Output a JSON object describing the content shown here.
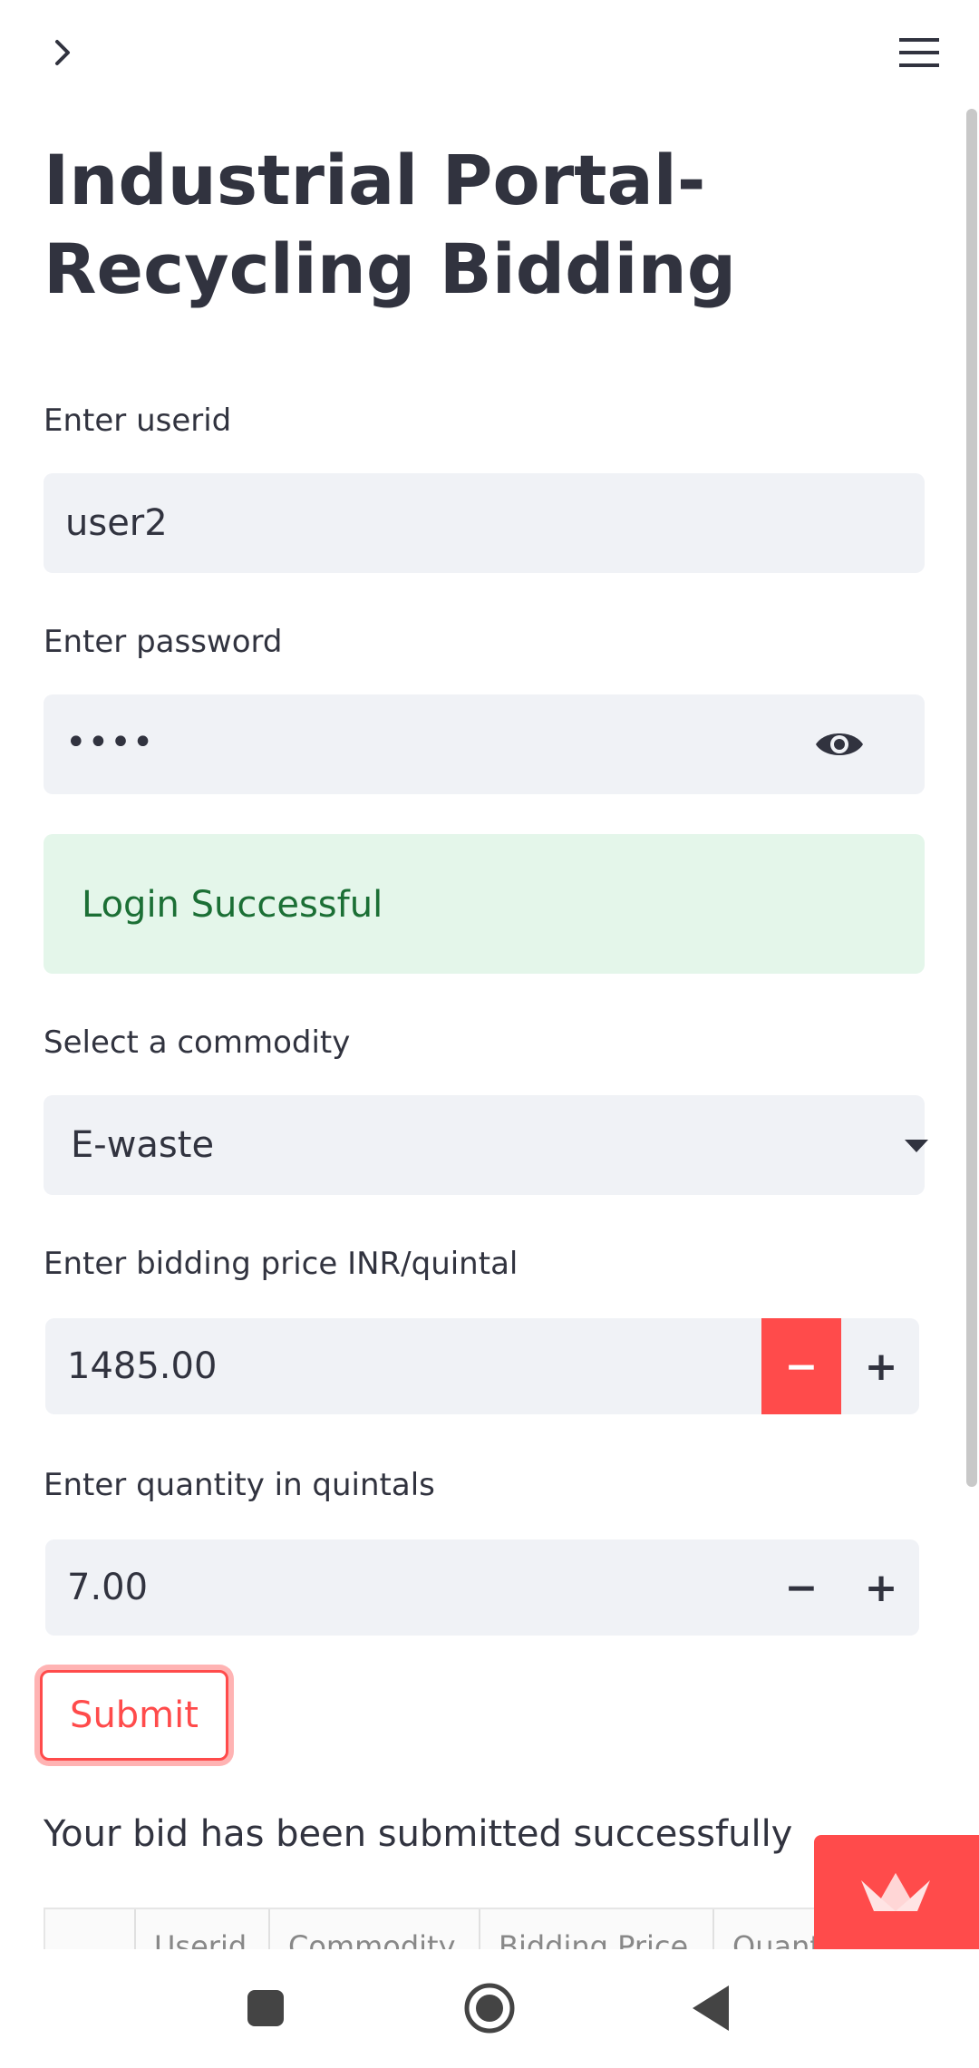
{
  "header": {
    "sidebar_toggle_icon": "chevron-right-icon",
    "menu_icon": "hamburger-menu-icon"
  },
  "page": {
    "title": "Industrial Portal- Recycling Bidding"
  },
  "form": {
    "userid": {
      "label": "Enter userid",
      "value": "user2"
    },
    "password": {
      "label": "Enter password",
      "masked_value": "••••",
      "toggle_icon": "eye-icon"
    },
    "login_status": {
      "text": "Login Successful",
      "color": "#1b6f35",
      "background": "#e4f6ea"
    },
    "commodity": {
      "label": "Select a commodity",
      "selected": "E-waste"
    },
    "bidding_price": {
      "label": "Enter bidding price INR/quintal",
      "value": "1485.00",
      "minus": "−",
      "plus": "+"
    },
    "quantity": {
      "label": "Enter quantity in quintals",
      "value": "7.00",
      "minus": "−",
      "plus": "+"
    },
    "submit_label": "Submit"
  },
  "result": {
    "message": "Your bid has been submitted successfully",
    "table_headers": [
      "",
      "Userid",
      "Commodity",
      "Bidding Price",
      "Quantity"
    ]
  },
  "theme": {
    "accent": "#ff4b4b",
    "input_bg": "#f0f2f6",
    "text": "#31333f"
  },
  "system_nav": {
    "icons": [
      "recent-apps-icon",
      "home-icon",
      "back-icon"
    ]
  }
}
